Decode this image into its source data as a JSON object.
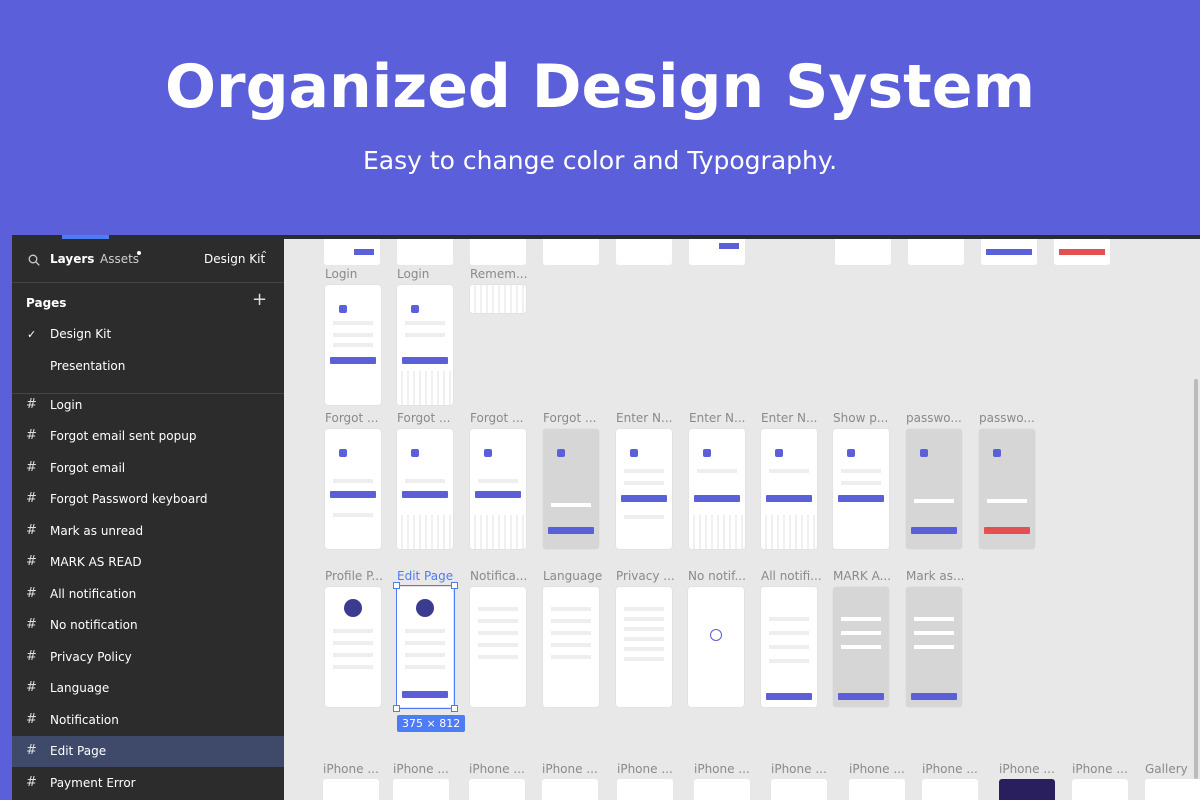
{
  "hero": {
    "title": "Organized Design System",
    "subtitle": "Easy to change color and Typography."
  },
  "sidebar": {
    "tab_layers": "Layers",
    "tab_assets": "Assets",
    "kit_name": "Design Kit",
    "pages_heading": "Pages",
    "pages": [
      "Design Kit",
      "Presentation"
    ],
    "layers": [
      "Login",
      "Forgot email sent popup",
      "Forgot email",
      "Forgot Password keyboard",
      "Mark as unread",
      "MARK AS READ",
      "All notification",
      "No notification",
      "Privacy Policy",
      "Language",
      "Notification",
      "Edit Page",
      "Payment Error"
    ]
  },
  "canvas": {
    "row1_labels": [
      "Login",
      "Login",
      "Remem..."
    ],
    "row2_labels": [
      "Forgot ...",
      "Forgot ...",
      "Forgot ...",
      "Forgot ...",
      "Enter N...",
      "Enter N...",
      "Enter N...",
      "Show p...",
      "passwo...",
      "passwo..."
    ],
    "row3_labels": [
      "Profile P...",
      "Edit Page",
      "Notifica...",
      "Language",
      "Privacy ...",
      "No notif...",
      "All notifi...",
      "MARK A...",
      "Mark as..."
    ],
    "row4_labels": [
      "iPhone ...",
      "iPhone ...",
      "iPhone ...",
      "iPhone ...",
      "iPhone ...",
      "iPhone ...",
      "iPhone ...",
      "iPhone ...",
      "iPhone ...",
      "iPhone ...",
      "iPhone ...",
      "Gallery"
    ],
    "size_badge": "375 × 812"
  },
  "colors": {
    "brand": "#5b5fd9",
    "selection": "#4d7cf5",
    "danger": "#e35050"
  }
}
